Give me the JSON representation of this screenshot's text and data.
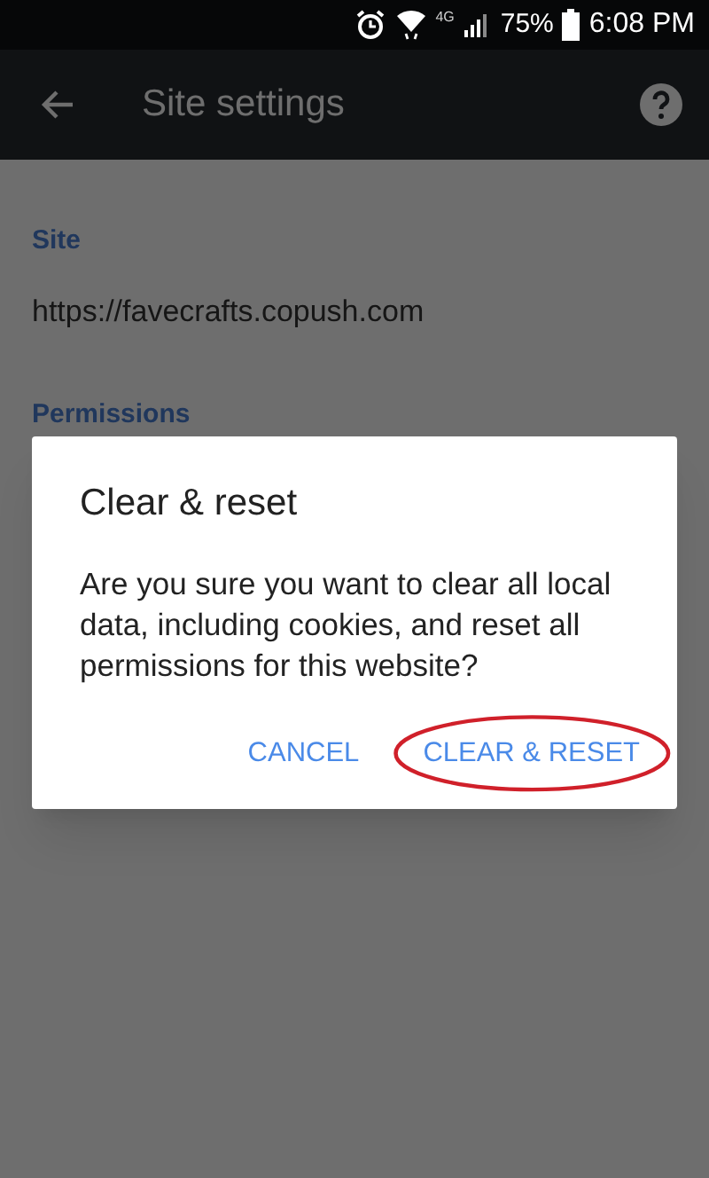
{
  "status_bar": {
    "network": "4G",
    "battery": "75%",
    "time": "6:08 PM"
  },
  "toolbar": {
    "title": "Site settings"
  },
  "sections": [
    {
      "kind": "header",
      "text": "Site"
    },
    {
      "kind": "value",
      "text": "https://favecrafts.copush.com"
    },
    {
      "kind": "header",
      "text": "Permissions"
    }
  ],
  "dialog": {
    "title": "Clear & reset",
    "message": "Are you sure you want to clear all local data, including cookies, and reset all permissions for this website?",
    "buttons": [
      {
        "label": "CANCEL",
        "circled": false
      },
      {
        "label": "CLEAR & RESET",
        "circled": true
      }
    ]
  }
}
